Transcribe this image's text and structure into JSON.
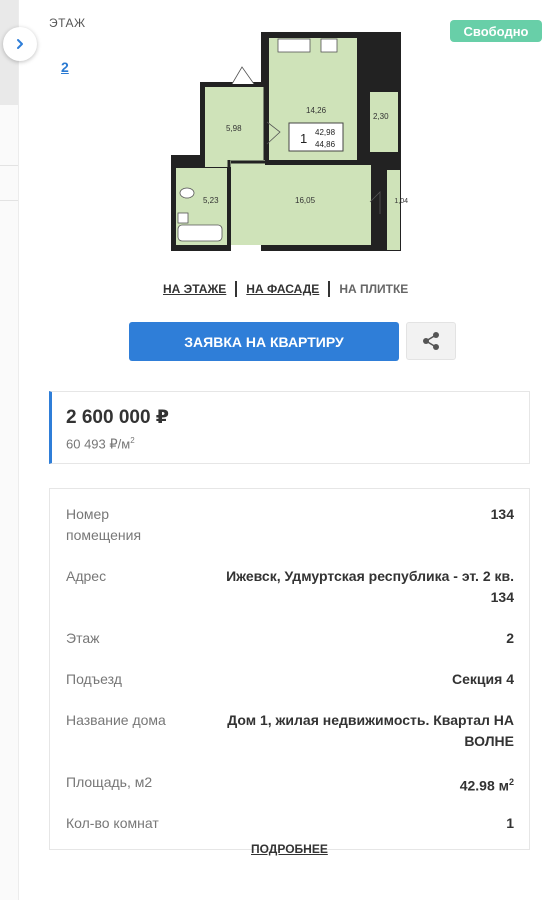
{
  "floor": {
    "label": "ЭТАЖ",
    "number": "2"
  },
  "status": "Свободно",
  "plan": {
    "room_count": "1",
    "area_living": "42,98",
    "area_total": "44,86",
    "rooms": {
      "kitchen": "14,26",
      "hall": "5,98",
      "balcony": "2,30",
      "bathroom": "5,23",
      "bedroom": "16,05",
      "loggia": "1,04"
    }
  },
  "view_links": [
    "НА ЭТАЖЕ",
    "НА ФАСАДЕ",
    "НА ПЛИТКЕ"
  ],
  "apply_button": "ЗАЯВКА НА КВАРТИРУ",
  "price": {
    "total": "2 600 000 ₽",
    "per_sqm": "60 493 ₽/м",
    "per_sqm_sup": "2"
  },
  "details": [
    {
      "label": "Номер помещения",
      "value": "134"
    },
    {
      "label": "Адрес",
      "value": "Ижевск, Удмуртская республика - эт. 2 кв. 134"
    },
    {
      "label": "Этаж",
      "value": "2"
    },
    {
      "label": "Подъезд",
      "value": "Секция 4"
    },
    {
      "label": "Название дома",
      "value": "Дом 1, жилая недвижимость. Квартал НА ВОЛНЕ"
    },
    {
      "label": "Площадь, м2",
      "value": "42.98 м",
      "value_sup": "2"
    },
    {
      "label": "Кол-во комнат",
      "value": "1"
    }
  ],
  "more_link": "ПОДРОБНЕЕ",
  "colors": {
    "accent": "#2f7ed8",
    "status": "#68cfa8",
    "room_fill": "#cfe3b9",
    "wall": "#222222"
  }
}
